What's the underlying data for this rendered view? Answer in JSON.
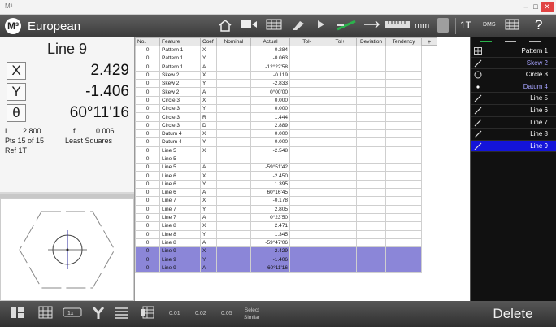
{
  "window": {
    "title": "M³",
    "min": "–",
    "max": "□",
    "close": "✕"
  },
  "app": {
    "logo": "M³",
    "name": "European"
  },
  "toolbar": {
    "home_icon": "home-icon",
    "unit": "mm",
    "tolerance_mode": "1T",
    "angle_mode": "DMS",
    "help": "?"
  },
  "dro": {
    "feature": "Line 9",
    "axes": [
      {
        "label": "X",
        "value": "2.429"
      },
      {
        "label": "Y",
        "value": "-1.406"
      },
      {
        "label": "θ",
        "value": "60°11'16"
      }
    ],
    "length_label": "L",
    "length_value": "2.800",
    "form_label": "f",
    "form_value": "0.006",
    "points": "Pts 15 of 15",
    "fit_method": "Least Squares",
    "reference": "Ref 1T"
  },
  "table": {
    "headers": [
      "No.",
      "Feature",
      "Coef",
      "Nominal",
      "Actual",
      "Tol-",
      "Tol+",
      "Deviation",
      "Tendency"
    ],
    "add_column": "+",
    "rows": [
      [
        "0",
        "Pattern 1",
        "X",
        "",
        "-0.284"
      ],
      [
        "0",
        "Pattern 1",
        "Y",
        "",
        "-0.063"
      ],
      [
        "0",
        "Pattern 1",
        "A",
        "",
        "-12°22'58"
      ],
      [
        "0",
        "Skew 2",
        "X",
        "",
        "-0.119"
      ],
      [
        "0",
        "Skew 2",
        "Y",
        "",
        "-2.833"
      ],
      [
        "0",
        "Skew 2",
        "A",
        "",
        "0°00'00"
      ],
      [
        "0",
        "Circle 3",
        "X",
        "",
        "0.000"
      ],
      [
        "0",
        "Circle 3",
        "Y",
        "",
        "0.000"
      ],
      [
        "0",
        "Circle 3",
        "R",
        "",
        "1.444"
      ],
      [
        "0",
        "Circle 3",
        "D",
        "",
        "2.889"
      ],
      [
        "0",
        "Datum 4",
        "X",
        "",
        "0.000"
      ],
      [
        "0",
        "Datum 4",
        "Y",
        "",
        "0.000"
      ],
      [
        "0",
        "Line 5",
        "X",
        "",
        "-2.548"
      ],
      [
        "0",
        "Line 5",
        "",
        "",
        ""
      ],
      [
        "0",
        "Line 5",
        "A",
        "",
        "-59°51'42"
      ],
      [
        "0",
        "Line 6",
        "X",
        "",
        "-2.450"
      ],
      [
        "0",
        "Line 6",
        "Y",
        "",
        "1.395"
      ],
      [
        "0",
        "Line 6",
        "A",
        "",
        "60°16'45"
      ],
      [
        "0",
        "Line 7",
        "X",
        "",
        "-0.178"
      ],
      [
        "0",
        "Line 7",
        "Y",
        "",
        "2.805"
      ],
      [
        "0",
        "Line 7",
        "A",
        "",
        "0°23'50"
      ],
      [
        "0",
        "Line 8",
        "X",
        "",
        "2.471"
      ],
      [
        "0",
        "Line 8",
        "Y",
        "",
        "1.345"
      ],
      [
        "0",
        "Line 8",
        "A",
        "",
        "-59°47'06"
      ],
      [
        "0",
        "Line 9",
        "X",
        "",
        "2.429"
      ],
      [
        "0",
        "Line 9",
        "Y",
        "",
        "-1.406"
      ],
      [
        "0",
        "Line 9",
        "A",
        "",
        "60°11'16"
      ]
    ],
    "selected_feature": "Line 9"
  },
  "features": [
    {
      "name": "Pattern 1",
      "icon": "pattern-icon"
    },
    {
      "name": "Skew 2",
      "icon": "line-icon"
    },
    {
      "name": "Circle 3",
      "icon": "circle-icon"
    },
    {
      "name": "Datum 4",
      "icon": "point-icon"
    },
    {
      "name": "Line 5",
      "icon": "line-icon"
    },
    {
      "name": "Line 6",
      "icon": "line-icon"
    },
    {
      "name": "Line 7",
      "icon": "line-icon"
    },
    {
      "name": "Line 8",
      "icon": "line-icon"
    },
    {
      "name": "Line 9",
      "icon": "line-icon"
    }
  ],
  "colors": {
    "selection": "#8b86d8",
    "active_feature": "#1414d9",
    "sidebar_bg": "#111111",
    "accent_green": "#2bb24c"
  },
  "bottombar": {
    "res1": "0.01",
    "res2": "0.02",
    "res3": "0.05",
    "select_similar_1": "Select",
    "select_similar_2": "Similar",
    "delete": "Delete"
  }
}
